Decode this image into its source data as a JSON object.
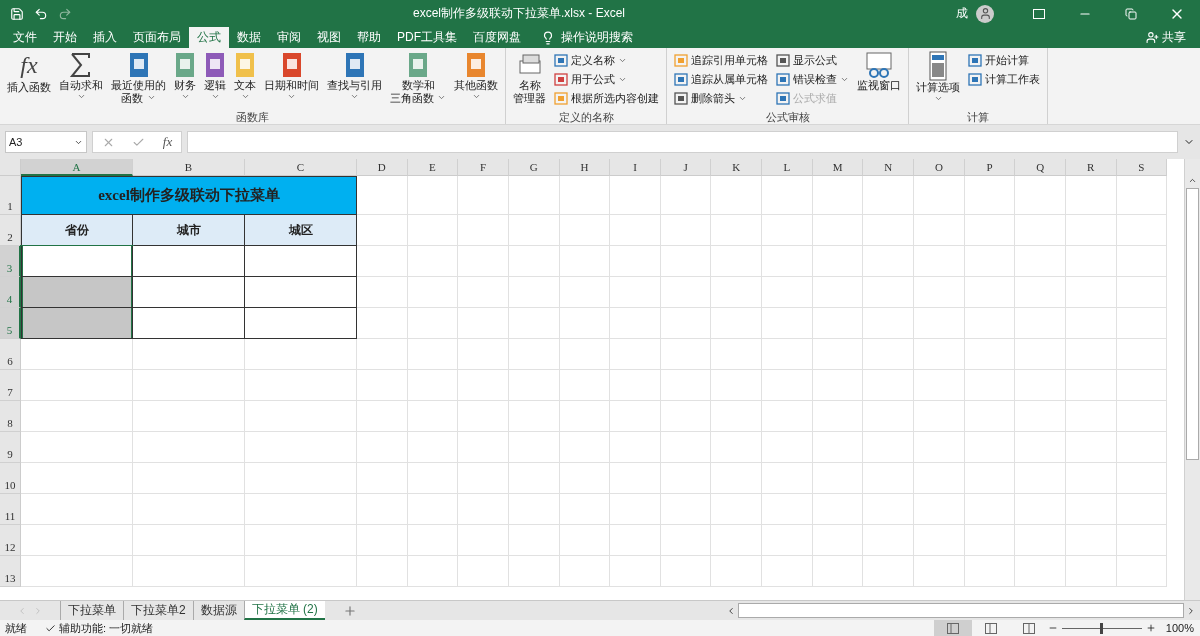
{
  "window": {
    "title": "excel制作多级联动下拉菜单.xlsx  -  Excel",
    "user": "成"
  },
  "ribbon_tabs": [
    {
      "label": "文件",
      "selected": false
    },
    {
      "label": "开始",
      "selected": false
    },
    {
      "label": "插入",
      "selected": false
    },
    {
      "label": "页面布局",
      "selected": false
    },
    {
      "label": "公式",
      "selected": true
    },
    {
      "label": "数据",
      "selected": false
    },
    {
      "label": "审阅",
      "selected": false
    },
    {
      "label": "视图",
      "selected": false
    },
    {
      "label": "帮助",
      "selected": false
    },
    {
      "label": "PDF工具集",
      "selected": false
    },
    {
      "label": "百度网盘",
      "selected": false
    }
  ],
  "tell_me": "操作说明搜索",
  "share": "共享",
  "ribbon_groups": [
    {
      "label": "函数库",
      "items": [
        {
          "kind": "large",
          "lines": [
            "插入函数"
          ],
          "glyph": "fx",
          "dropdown": false
        },
        {
          "kind": "large",
          "lines": [
            "自动求和"
          ],
          "dropdown": true
        },
        {
          "kind": "large",
          "lines": [
            "最近使用的",
            "函数"
          ],
          "dropdown": true
        },
        {
          "kind": "large",
          "lines": [
            "财务"
          ],
          "dropdown": true
        },
        {
          "kind": "large",
          "lines": [
            "逻辑"
          ],
          "dropdown": true
        },
        {
          "kind": "large",
          "lines": [
            "文本"
          ],
          "dropdown": true
        },
        {
          "kind": "large",
          "lines": [
            "日期和时间"
          ],
          "dropdown": true
        },
        {
          "kind": "large",
          "lines": [
            "查找与引用"
          ],
          "dropdown": true
        },
        {
          "kind": "large",
          "lines": [
            "数学和",
            "三角函数"
          ],
          "dropdown": true
        },
        {
          "kind": "large",
          "lines": [
            "其他函数"
          ],
          "dropdown": true
        }
      ]
    },
    {
      "label": "定义的名称",
      "items": [
        {
          "kind": "large",
          "lines": [
            "名称",
            "管理器"
          ],
          "dropdown": false
        },
        {
          "kind": "small",
          "label": "定义名称",
          "dropdown": true,
          "disabled": false
        },
        {
          "kind": "small",
          "label": "用于公式",
          "dropdown": true,
          "disabled": false
        },
        {
          "kind": "small",
          "label": "根据所选内容创建",
          "dropdown": false,
          "disabled": false
        }
      ]
    },
    {
      "label": "公式审核",
      "items": [
        {
          "kind": "small",
          "label": "追踪引用单元格",
          "dropdown": false,
          "disabled": false
        },
        {
          "kind": "small",
          "label": "追踪从属单元格",
          "dropdown": false,
          "disabled": false
        },
        {
          "kind": "small",
          "label": "删除箭头",
          "dropdown": true,
          "disabled": false
        },
        {
          "kind": "small",
          "label": "显示公式",
          "dropdown": false,
          "disabled": false
        },
        {
          "kind": "small",
          "label": "错误检查",
          "dropdown": true,
          "disabled": false
        },
        {
          "kind": "small",
          "label": "公式求值",
          "dropdown": false,
          "disabled": true
        },
        {
          "kind": "large",
          "lines": [
            "监视窗口"
          ],
          "dropdown": false
        }
      ]
    },
    {
      "label": "计算",
      "items": [
        {
          "kind": "large",
          "lines": [
            "计算选项"
          ],
          "dropdown": true
        },
        {
          "kind": "small",
          "label": "开始计算",
          "dropdown": false,
          "disabled": false
        },
        {
          "kind": "small",
          "label": "计算工作表",
          "dropdown": false,
          "disabled": false
        }
      ]
    }
  ],
  "formula_bar": {
    "name_box": "A3",
    "fx": "fx"
  },
  "columns": [
    {
      "label": "A",
      "selected": true
    },
    {
      "label": "B",
      "selected": false
    },
    {
      "label": "C",
      "selected": false
    },
    {
      "label": "D",
      "selected": false
    },
    {
      "label": "E",
      "selected": false
    },
    {
      "label": "F",
      "selected": false
    },
    {
      "label": "G",
      "selected": false
    },
    {
      "label": "H",
      "selected": false
    },
    {
      "label": "I",
      "selected": false
    },
    {
      "label": "J",
      "selected": false
    },
    {
      "label": "K",
      "selected": false
    },
    {
      "label": "L",
      "selected": false
    },
    {
      "label": "M",
      "selected": false
    },
    {
      "label": "N",
      "selected": false
    },
    {
      "label": "O",
      "selected": false
    },
    {
      "label": "P",
      "selected": false
    },
    {
      "label": "Q",
      "selected": false
    },
    {
      "label": "R",
      "selected": false
    },
    {
      "label": "S",
      "selected": false
    }
  ],
  "rows": [
    {
      "label": "1",
      "selected": false
    },
    {
      "label": "2",
      "selected": false
    },
    {
      "label": "3",
      "selected": true
    },
    {
      "label": "4",
      "selected": true
    },
    {
      "label": "5",
      "selected": true
    },
    {
      "label": "6",
      "selected": false
    },
    {
      "label": "7",
      "selected": false
    },
    {
      "label": "8",
      "selected": false
    },
    {
      "label": "9",
      "selected": false
    },
    {
      "label": "10",
      "selected": false
    },
    {
      "label": "11",
      "selected": false
    },
    {
      "label": "12",
      "selected": false
    },
    {
      "label": "13",
      "selected": false
    }
  ],
  "table": {
    "title": "excel制作多级联动下拉菜单",
    "headers": [
      "省份",
      "城市",
      "城区"
    ],
    "body": [
      [
        {
          "selected": true,
          "active": true
        },
        {
          "selected": false,
          "active": false
        },
        {
          "selected": false,
          "active": false
        }
      ],
      [
        {
          "selected": true,
          "active": false
        },
        {
          "selected": false,
          "active": false
        },
        {
          "selected": false,
          "active": false
        }
      ],
      [
        {
          "selected": true,
          "active": false
        },
        {
          "selected": false,
          "active": false
        },
        {
          "selected": false,
          "active": false
        }
      ]
    ]
  },
  "sheet_tabs": [
    {
      "label": "下拉菜单",
      "selected": false
    },
    {
      "label": "下拉菜单2",
      "selected": false
    },
    {
      "label": "数据源",
      "selected": false
    },
    {
      "label": "下拉菜单 (2)",
      "selected": true
    }
  ],
  "status_bar": {
    "ready": "就绪",
    "accessibility": "辅助功能: 一切就绪",
    "views": [
      {
        "selected": true
      },
      {
        "selected": false
      },
      {
        "selected": false
      }
    ],
    "zoom": {
      "level": 0.5,
      "label": "100%"
    }
  }
}
